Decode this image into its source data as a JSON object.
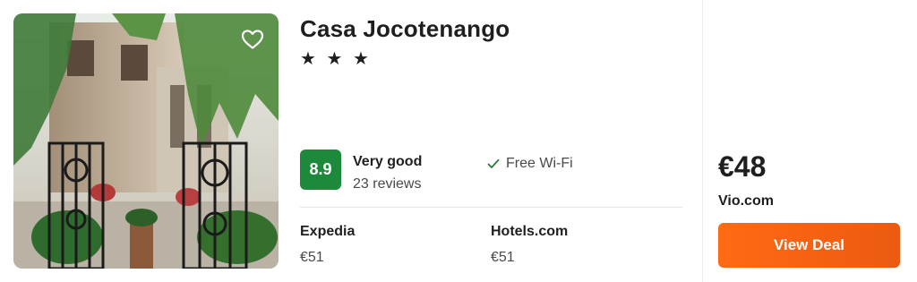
{
  "hotel": {
    "name": "Casa Jocotenango",
    "stars": "★ ★ ★",
    "star_count": 3
  },
  "rating": {
    "score": "8.9",
    "label": "Very good",
    "reviews": "23 reviews",
    "badge_color": "#1c8a3a"
  },
  "amenities": [
    {
      "label": "Free Wi-Fi",
      "icon": "check-icon"
    }
  ],
  "providers": [
    {
      "name": "Expedia",
      "price": "€51"
    },
    {
      "name": "Hotels.com",
      "price": "€51"
    }
  ],
  "deal": {
    "price": "€48",
    "provider": "Vio.com",
    "button_label": "View Deal",
    "button_color": "#ff6a13"
  },
  "icons": {
    "favorite": "heart-outline-icon"
  }
}
